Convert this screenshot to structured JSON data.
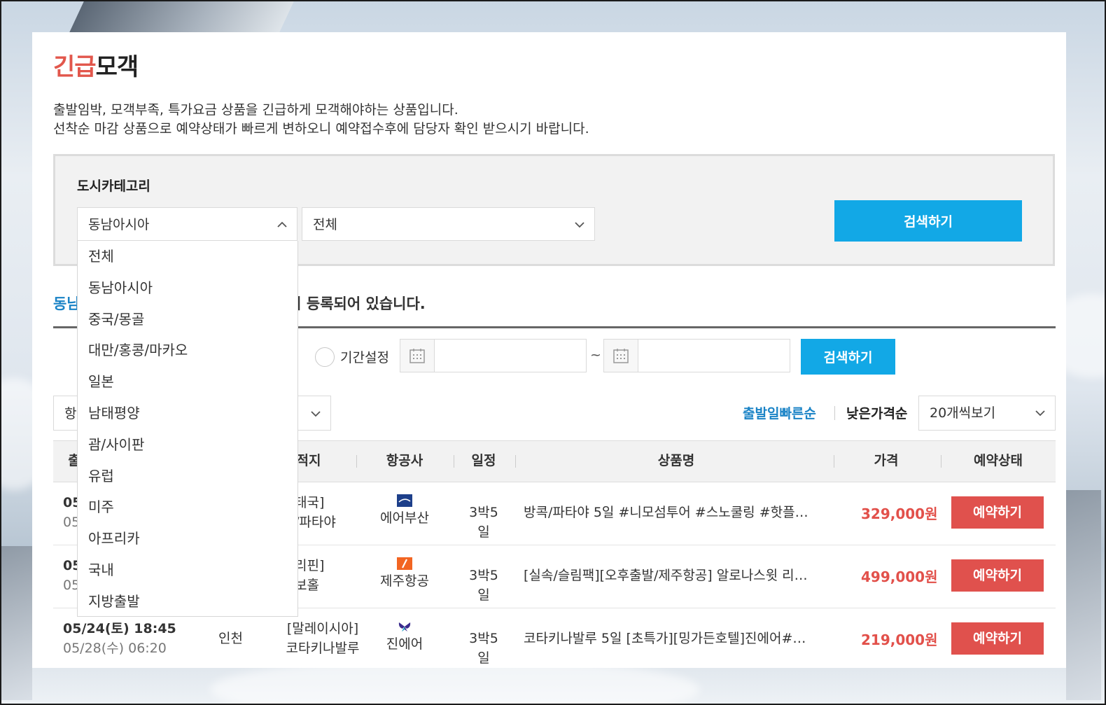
{
  "page": {
    "title_highlight": "긴급",
    "title_rest": "모객",
    "desc_line1": "출발임박, 모객부족, 특가요금 상품을 긴급하게 모객해야하는 상품입니다.",
    "desc_line2": "선착순 마감 상품으로 예약상태가 빠르게 변하오니 예약접수후에 담당자 확인 받으시기 바랍니다."
  },
  "filter": {
    "label": "도시카테고리",
    "region_selected": "동남아시아",
    "city_selected": "전체",
    "search_label": "검색하기",
    "region_options": [
      "전체",
      "동남아시아",
      "중국/몽골",
      "대만/홍콩/마카오",
      "일본",
      "남태평양",
      "괌/사이판",
      "유럽",
      "미주",
      "아프리카",
      "국내",
      "지방출발"
    ]
  },
  "result": {
    "prefix": "동남",
    "suffix": "상품이 등록되어 있습니다."
  },
  "period": {
    "label": "기간설정",
    "tilde": "~",
    "search_label": "검색하기"
  },
  "sort": {
    "left_prefix": "항",
    "fast_departure": "출발일빠른순",
    "low_price": "낮은가격순",
    "page_size": "20개씩보기"
  },
  "table": {
    "headers": {
      "col1": "출",
      "destination": "적지",
      "airline": "항공사",
      "schedule": "일정",
      "product": "상품명",
      "price": "가격",
      "status": "예약상태"
    },
    "rows": [
      {
        "dep": "05",
        "ret": "05",
        "from": "",
        "dest1": "태국]",
        "dest2": "/파타야",
        "airline": "에어부산",
        "airline_color": "#1d3f8a",
        "schedule": "3박5일",
        "product": "방콕/파타야 5일 #니모섬투어 #스노쿨링 #핫플…",
        "price": "329,000원",
        "button": "예약하기"
      },
      {
        "dep": "05",
        "ret": "05",
        "from": "",
        "dest1": "리핀]",
        "dest2": "보홀",
        "airline": "제주항공",
        "airline_color": "#f26522",
        "schedule": "3박5일",
        "product": "[실속/슬림팩][오후출발/제주항공] 알로나스윗 리…",
        "price": "499,000원",
        "button": "예약하기"
      },
      {
        "dep": "05/24(토) 18:45",
        "ret": "05/28(수) 06:20",
        "from": "인천",
        "dest1": "[말레이시아]",
        "dest2": "코타키나발루",
        "airline": "진에어",
        "airline_color": "#3a2a8c",
        "schedule": "3박5일",
        "product": "코타키나발루 5일 [초특가][밍가든호텔]진에어#…",
        "price": "219,000원",
        "button": "예약하기"
      }
    ]
  },
  "colors": {
    "accent_red": "#e2574c",
    "accent_blue": "#12a8e6",
    "link_blue": "#1a83c6"
  },
  "icons": {
    "chevron_up": "chevron-up-icon",
    "chevron_down": "chevron-down-icon",
    "calendar": "calendar-icon"
  }
}
